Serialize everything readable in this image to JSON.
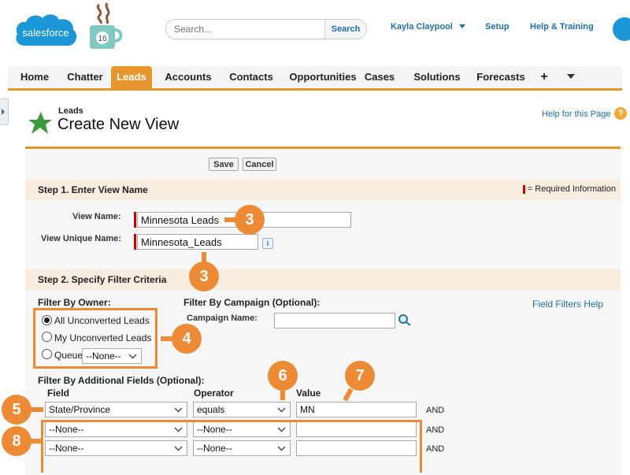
{
  "header": {
    "logo_text": "salesforce",
    "mug_badge": "16",
    "search_placeholder": "Search...",
    "search_button": "Search",
    "user_name": "Kayla Claypool",
    "setup": "Setup",
    "help_training": "Help & Training"
  },
  "tabs": [
    "Home",
    "Chatter",
    "Leads",
    "Accounts",
    "Contacts",
    "Opportunities",
    "Cases",
    "Solutions",
    "Forecasts",
    "+"
  ],
  "active_tab": "Leads",
  "page": {
    "breadcrumb": "Leads",
    "title": "Create New View",
    "help_link": "Help for this Page",
    "help_icon": "?"
  },
  "buttons": {
    "save": "Save",
    "cancel": "Cancel"
  },
  "step1": {
    "title": "Step 1. Enter View Name",
    "required_info": "= Required Information",
    "view_name_label": "View Name:",
    "view_name_value": "Minnesota Leads",
    "unique_name_label": "View Unique Name:",
    "unique_name_value": "Minnesota_Leads",
    "info_icon": "i"
  },
  "step2": {
    "title": "Step 2. Specify Filter Criteria",
    "filter_owner_label": "Filter By Owner:",
    "owner_options": [
      "All Unconverted Leads",
      "My Unconverted Leads",
      "Queue"
    ],
    "queue_value": "--None--",
    "campaign_label": "Filter By Campaign (Optional):",
    "campaign_name_label": "Campaign Name:",
    "campaign_value": "",
    "field_filters_help": "Field Filters Help",
    "additional_label": "Filter By Additional Fields (Optional):",
    "columns": {
      "field": "Field",
      "operator": "Operator",
      "value": "Value"
    },
    "rows": [
      {
        "field": "State/Province",
        "operator": "equals",
        "value": "MN",
        "join": "AND"
      },
      {
        "field": "--None--",
        "operator": "--None--",
        "value": "",
        "join": "AND"
      },
      {
        "field": "--None--",
        "operator": "--None--",
        "value": "",
        "join": "AND"
      }
    ]
  },
  "callouts": [
    "3",
    "3",
    "4",
    "5",
    "6",
    "7",
    "8"
  ],
  "colors": {
    "accent": "#EC8A35",
    "tab_active": "#E7962E",
    "link": "#1E6EA0",
    "required": "#CC0000"
  }
}
